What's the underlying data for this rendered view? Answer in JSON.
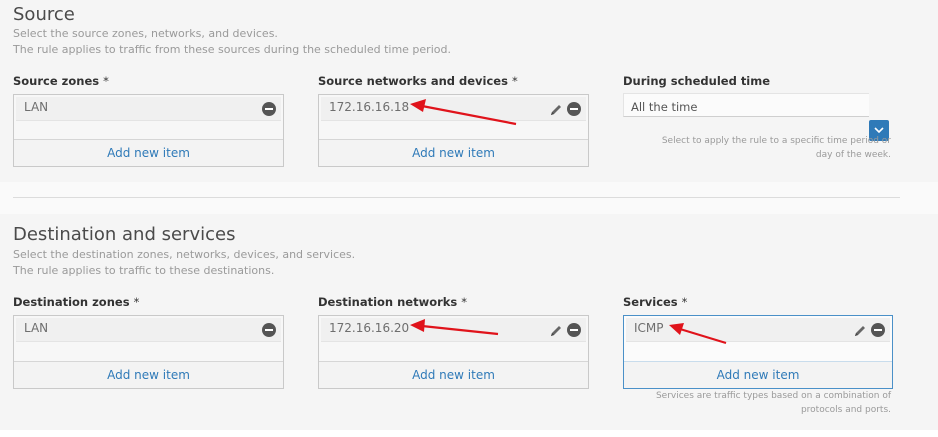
{
  "source": {
    "title": "Source",
    "desc1": "Select the source zones, networks, and devices.",
    "desc2": "The rule applies to traffic from these sources during the scheduled time period.",
    "zones": {
      "label": "Source zones",
      "required": "*",
      "items": [
        "LAN"
      ],
      "add_label": "Add new item"
    },
    "networks": {
      "label": "Source networks and devices",
      "required": "*",
      "items": [
        "172.16.16.18"
      ],
      "add_label": "Add new item"
    },
    "schedule": {
      "label": "During scheduled time",
      "value": "All the time",
      "help1": "Select to apply the rule to a specific time period or",
      "help2": "day of the week."
    }
  },
  "destination": {
    "title": "Destination and services",
    "desc1": "Select the destination zones, networks, devices, and services.",
    "desc2": "The rule applies to traffic to these destinations.",
    "zones": {
      "label": "Destination zones",
      "required": "*",
      "items": [
        "LAN"
      ],
      "add_label": "Add new item"
    },
    "networks": {
      "label": "Destination networks",
      "required": "*",
      "items": [
        "172.16.16.20"
      ],
      "add_label": "Add new item"
    },
    "services": {
      "label": "Services",
      "required": "*",
      "items": [
        "ICMP"
      ],
      "add_label": "Add new item",
      "help1": "Services are traffic types based on a combination of",
      "help2": "protocols and ports."
    }
  },
  "colors": {
    "accent": "#2f7ab8",
    "annotation_arrow": "#e0131b"
  },
  "icons": {
    "remove": "minus-circle-icon",
    "edit": "pencil-icon",
    "dropdown": "chevron-down-icon"
  }
}
